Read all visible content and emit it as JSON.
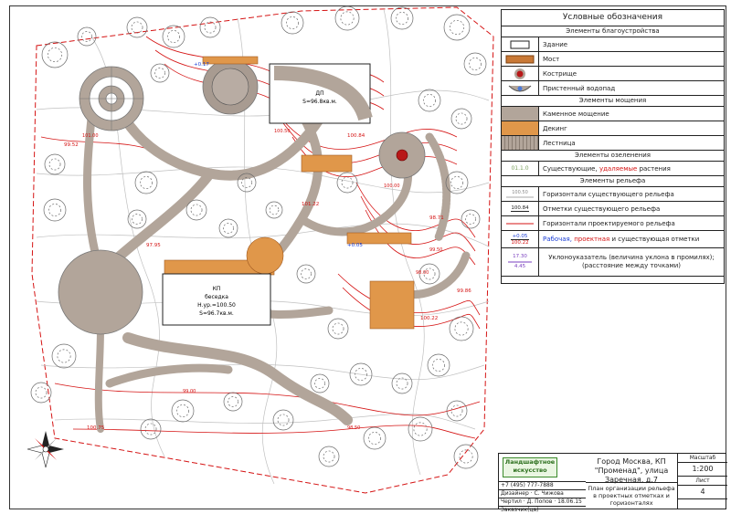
{
  "legend": {
    "title": "Условные обозначения",
    "sections": {
      "landscaping": "Элементы благоустройства",
      "paving": "Элементы мощения",
      "greenery": "Элементы озеленения",
      "relief": "Элементы рельефа"
    },
    "items": {
      "building": "Здание",
      "bridge": "Мост",
      "firepit": "Кострище",
      "waterfall": "Пристенный водопад",
      "stone": "Каменное мощение",
      "decking": "Декинг",
      "stairs": "Лестница",
      "plants_a": "Существующие,",
      "plants_b": "удаляемые",
      "plants_c": "растения",
      "existing_contours": "Горизонтали существующего рельефа",
      "existing_marks": "Отметки существующего рельефа",
      "design_contours": "Горизонтали проектируемого рельефа",
      "marks_a": "Рабочая,",
      "marks_b": "проектная",
      "marks_c": "и существующая отметки",
      "slope_line1": "Уклоноуказатель (величина уклона в промилях);",
      "slope_line2": "(расстояние между точками)"
    },
    "symbol_labels": {
      "contour_sample": "100.50",
      "mark_sample": "100.84",
      "work_mark": "+0.05",
      "design_mark": "100.22",
      "slope_sample": "17.30",
      "slope_dist": "4.45",
      "plant_sample": "01.1.0"
    }
  },
  "plan": {
    "house_label": "КП",
    "house_name": "беседка",
    "house_level": "Н.ур.=100.50",
    "house_area": "S=96.7кв.м.",
    "pavilion_label": "ДП",
    "pavilion_area": "S=96.8кв.м.",
    "sample_marks": [
      "+0.17",
      "100.84",
      "99.52",
      "100.75",
      "101.22",
      "98.71",
      "+0.05",
      "100.22",
      "97.95",
      "99.86"
    ],
    "contour_labels": [
      "101.00",
      "100.50",
      "100.00",
      "99.50",
      "99.00",
      "98.50",
      "98.00"
    ]
  },
  "titleblock": {
    "company_line1": "Ландшафтное",
    "company_line2": "искусство",
    "project": "Город Москва, КП \"Променад\", улица Заречная, д.7",
    "sheet_title": "План организации рельефа в проектных отметках и горизонталях",
    "contacts": "+7 (495) 777-7888",
    "role1": "Дизайнер",
    "name1": "С. Чижова",
    "role2": "Чертил",
    "name2": "Д. Попов",
    "role3": "Заказчик(ца)",
    "sign": "Подпись",
    "date_label": "Дата",
    "date": "18.06.15",
    "scale_label": "Масштаб",
    "scale": "1:200",
    "sheet_label": "Лист",
    "sheet_no": "4"
  },
  "colors": {
    "existing_contour": "#c0c0c0",
    "design_contour": "#d51414",
    "paving": "#b2a59a",
    "decking": "#e0974a",
    "tree_outline": "#6a6a6a",
    "mark_blue": "#1c3fd6"
  }
}
